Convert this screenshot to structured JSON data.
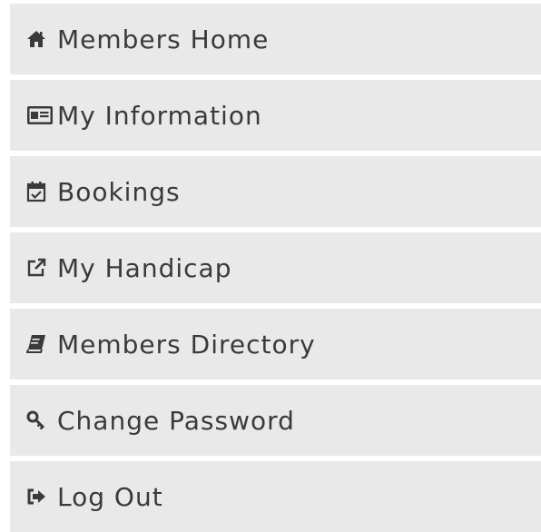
{
  "menu": {
    "items": [
      {
        "label": "Members Home",
        "icon": "home-icon"
      },
      {
        "label": "My Information",
        "icon": "id-card-icon"
      },
      {
        "label": "Bookings",
        "icon": "calendar-check-icon"
      },
      {
        "label": "My Handicap",
        "icon": "external-link-icon"
      },
      {
        "label": "Members Directory",
        "icon": "book-icon"
      },
      {
        "label": "Change Password",
        "icon": "key-icon"
      },
      {
        "label": "Log Out",
        "icon": "sign-out-icon"
      }
    ]
  },
  "colors": {
    "item_background": "#e9e9e9",
    "text": "#3a3a3a",
    "page_background": "#ffffff"
  }
}
